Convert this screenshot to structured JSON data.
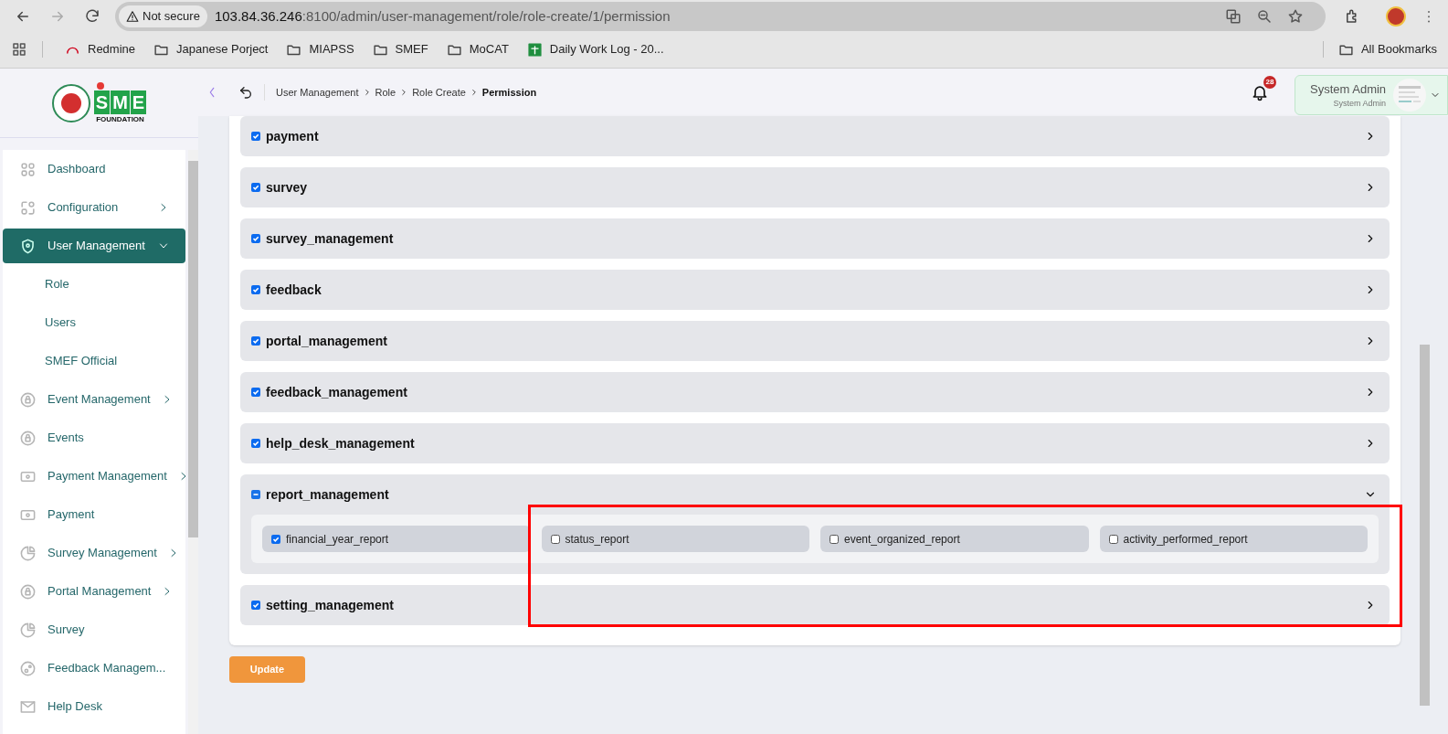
{
  "browser": {
    "security": "Not secure",
    "url_host": "103.84.36.246",
    "url_rest": ":8100/admin/user-management/role/role-create/1/permission",
    "bookmarks": [
      {
        "label": "Redmine",
        "kind": "site"
      },
      {
        "label": "Japanese Porject",
        "kind": "folder"
      },
      {
        "label": "MIAPSS",
        "kind": "folder"
      },
      {
        "label": "SMEF",
        "kind": "folder"
      },
      {
        "label": "MoCAT",
        "kind": "folder"
      },
      {
        "label": "Daily Work Log - 20...",
        "kind": "sheet"
      }
    ],
    "all_bookmarks": "All Bookmarks"
  },
  "logo": {
    "letters": [
      "S",
      "M",
      "E"
    ],
    "subtitle": "FOUNDATION"
  },
  "breadcrumb": [
    {
      "label": "User Management",
      "current": false
    },
    {
      "label": "Role",
      "current": false
    },
    {
      "label": "Role Create",
      "current": false
    },
    {
      "label": "Permission",
      "current": true
    }
  ],
  "notification_count": "28",
  "user": {
    "name": "System Admin",
    "role": "System Admin"
  },
  "sidebar": [
    {
      "label": "Dashboard",
      "selected": false
    },
    {
      "label": "Configuration",
      "expanded": false,
      "selected": false
    },
    {
      "label": "User Management",
      "expanded": true,
      "selected": true,
      "children": [
        {
          "label": "Role"
        },
        {
          "label": "Users"
        },
        {
          "label": "SMEF Official"
        }
      ]
    },
    {
      "label": "Event Management",
      "expanded": false,
      "selected": false
    },
    {
      "label": "Events",
      "selected": false
    },
    {
      "label": "Payment Management",
      "expanded": false,
      "selected": false
    },
    {
      "label": "Payment",
      "selected": false
    },
    {
      "label": "Survey Management",
      "expanded": false,
      "selected": false
    },
    {
      "label": "Portal Management",
      "expanded": false,
      "selected": false
    },
    {
      "label": "Survey",
      "selected": false
    },
    {
      "label": "Feedback Managem...",
      "selected": false
    },
    {
      "label": "Help Desk",
      "selected": false
    }
  ],
  "permissions": [
    {
      "label": "payment",
      "checked": true,
      "indeterminate": false,
      "expanded": false
    },
    {
      "label": "survey",
      "checked": true,
      "indeterminate": false,
      "expanded": false
    },
    {
      "label": "survey_management",
      "checked": true,
      "indeterminate": false,
      "expanded": false
    },
    {
      "label": "feedback",
      "checked": true,
      "indeterminate": false,
      "expanded": false
    },
    {
      "label": "portal_management",
      "checked": true,
      "indeterminate": false,
      "expanded": false
    },
    {
      "label": "feedback_management",
      "checked": true,
      "indeterminate": false,
      "expanded": false
    },
    {
      "label": "help_desk_management",
      "checked": true,
      "indeterminate": false,
      "expanded": false
    },
    {
      "label": "report_management",
      "checked": false,
      "indeterminate": true,
      "expanded": true,
      "children": [
        {
          "label": "financial_year_report",
          "checked": true
        },
        {
          "label": "status_report",
          "checked": false
        },
        {
          "label": "event_organized_report",
          "checked": false
        },
        {
          "label": "activity_performed_report",
          "checked": false
        }
      ]
    },
    {
      "label": "setting_management",
      "checked": true,
      "indeterminate": false,
      "expanded": false
    }
  ],
  "update_button": "Update"
}
